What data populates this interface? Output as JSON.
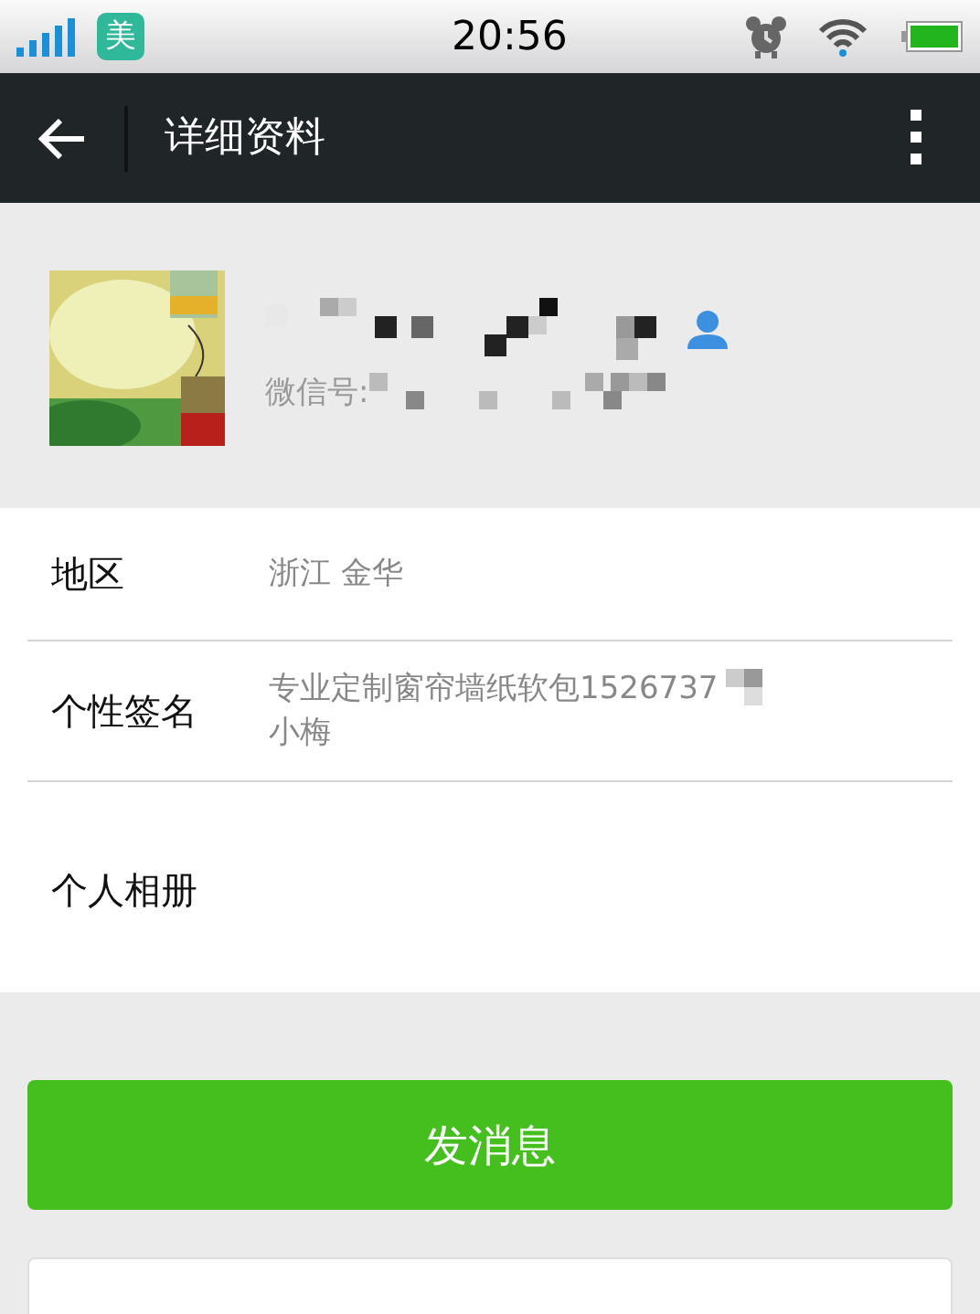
{
  "status_bar": {
    "app_badge": "美",
    "time": "20:56"
  },
  "header": {
    "title": "详细资料"
  },
  "profile": {
    "wechat_id_label": "微信号:"
  },
  "details": [
    {
      "label": "地区",
      "lines": [
        "浙江 金华"
      ]
    },
    {
      "label": "个性签名",
      "lines": [
        "专业定制窗帘墙纸软包1526737",
        "小梅"
      ]
    },
    {
      "label": "个人相册"
    }
  ],
  "buttons": [
    {
      "label": "发消息",
      "kind": "primary"
    },
    {
      "kind": "secondary"
    }
  ]
}
